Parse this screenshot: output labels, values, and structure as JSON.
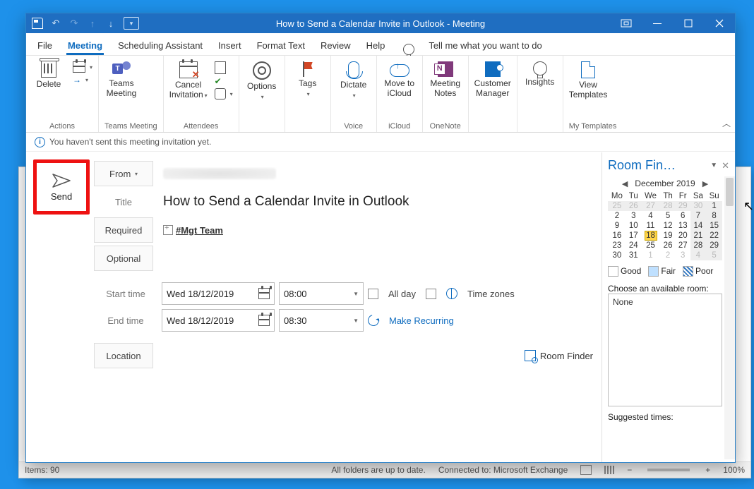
{
  "titlebar": {
    "title": "How to Send a Calendar Invite in Outlook  -  Meeting"
  },
  "menu": {
    "items": [
      "File",
      "Meeting",
      "Scheduling Assistant",
      "Insert",
      "Format Text",
      "Review",
      "Help"
    ],
    "active": "Meeting",
    "tell_me": "Tell me what you want to do"
  },
  "ribbon": {
    "actions": {
      "group": "Actions",
      "delete": "Delete"
    },
    "teams": {
      "group": "Teams Meeting",
      "btn": "Teams\nMeeting"
    },
    "attendees": {
      "group": "Attendees",
      "cancel": "Cancel\nInvitation"
    },
    "options": {
      "btn": "Options"
    },
    "tags": {
      "btn": "Tags"
    },
    "voice": {
      "group": "Voice",
      "btn": "Dictate"
    },
    "icloud": {
      "group": "iCloud",
      "btn": "Move to\niCloud"
    },
    "onenote": {
      "group": "OneNote",
      "btn": "Meeting\nNotes"
    },
    "cm": {
      "btn": "Customer\nManager"
    },
    "insights": {
      "btn": "Insights"
    },
    "templates": {
      "group": "My Templates",
      "btn": "View\nTemplates"
    }
  },
  "info_bar": "You haven't sent this meeting invitation yet.",
  "form": {
    "send": "Send",
    "from": "From",
    "title_label": "Title",
    "title_value": "How to Send a Calendar Invite in Outlook",
    "required_label": "Required",
    "required_value": "#Mgt Team",
    "optional_label": "Optional",
    "start_label": "Start time",
    "end_label": "End time",
    "start_date": "Wed 18/12/2019",
    "start_time": "08:00",
    "end_date": "Wed 18/12/2019",
    "end_time": "08:30",
    "all_day": "All day",
    "time_zones": "Time zones",
    "make_recurring": "Make Recurring",
    "location_label": "Location",
    "room_finder_btn": "Room Finder"
  },
  "roomfinder": {
    "title": "Room Fin…",
    "month": "December 2019",
    "dow": [
      "Mo",
      "Tu",
      "We",
      "Th",
      "Fr",
      "Sa",
      "Su"
    ],
    "weeks": [
      [
        {
          "d": 25,
          "dim": 1,
          "g": 1
        },
        {
          "d": 26,
          "dim": 1,
          "g": 1
        },
        {
          "d": 27,
          "dim": 1,
          "g": 1
        },
        {
          "d": 28,
          "dim": 1,
          "g": 1
        },
        {
          "d": 29,
          "dim": 1,
          "g": 1
        },
        {
          "d": 30,
          "dim": 1,
          "g": 1
        },
        {
          "d": 1,
          "g": 1
        }
      ],
      [
        {
          "d": 2
        },
        {
          "d": 3
        },
        {
          "d": 4
        },
        {
          "d": 5
        },
        {
          "d": 6
        },
        {
          "d": 7,
          "g": 1
        },
        {
          "d": 8,
          "g": 1
        }
      ],
      [
        {
          "d": 9
        },
        {
          "d": 10
        },
        {
          "d": 11
        },
        {
          "d": 12
        },
        {
          "d": 13
        },
        {
          "d": 14,
          "g": 1
        },
        {
          "d": 15,
          "g": 1
        }
      ],
      [
        {
          "d": 16
        },
        {
          "d": 17
        },
        {
          "d": 18,
          "today": 1
        },
        {
          "d": 19
        },
        {
          "d": 20
        },
        {
          "d": 21,
          "g": 1
        },
        {
          "d": 22,
          "g": 1
        }
      ],
      [
        {
          "d": 23
        },
        {
          "d": 24
        },
        {
          "d": 25
        },
        {
          "d": 26
        },
        {
          "d": 27
        },
        {
          "d": 28,
          "g": 1
        },
        {
          "d": 29,
          "g": 1
        }
      ],
      [
        {
          "d": 30
        },
        {
          "d": 31
        },
        {
          "d": 1,
          "dim": 1
        },
        {
          "d": 2,
          "dim": 1
        },
        {
          "d": 3,
          "dim": 1
        },
        {
          "d": 4,
          "dim": 1,
          "g": 1
        },
        {
          "d": 5,
          "dim": 1,
          "g": 1
        }
      ]
    ],
    "legend": {
      "good": "Good",
      "fair": "Fair",
      "poor": "Poor"
    },
    "choose": "Choose an available room:",
    "none": "None",
    "suggested": "Suggested times:"
  },
  "statusbar": {
    "items": "Items: 90",
    "folders": "All folders are up to date.",
    "connected": "Connected to: Microsoft Exchange",
    "zoom": "100%"
  }
}
